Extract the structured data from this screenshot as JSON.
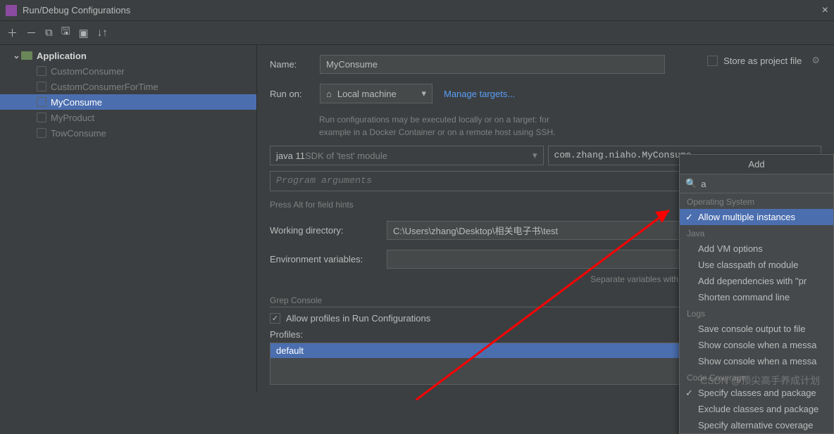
{
  "window": {
    "title": "Run/Debug Configurations"
  },
  "tree": {
    "header": "Application",
    "items": [
      "CustomConsumer",
      "CustomConsumerForTime",
      "MyConsume",
      "MyProduct",
      "TowConsume"
    ],
    "selected_index": 2
  },
  "form": {
    "name_label": "Name:",
    "name_value": "MyConsume",
    "store_label": "Store as project file",
    "runon_label": "Run on:",
    "runon_value": "Local machine",
    "manage_targets": "Manage targets...",
    "runon_hint1": "Run configurations may be executed locally or on a target: for",
    "runon_hint2": "example in a Docker Container or on a remote host using SSH.",
    "sdk_text": "java 11",
    "sdk_hint": " SDK of 'test' module",
    "main_class": "com.zhang.niaho.MyConsume",
    "prog_args_placeholder": "Program arguments",
    "alt_hint": "Press Alt for field hints",
    "workdir_label": "Working directory:",
    "workdir_value": "C:\\Users\\zhang\\Desktop\\相关电子书\\test",
    "env_label": "Environment variables:",
    "env_hint": "Separate variables with semicolon: VAR=value; VAR1=value1",
    "grep_label": "Grep Console",
    "allow_profiles": "Allow profiles in Run Configurations",
    "profiles_label": "Profiles:",
    "profiles_item": "default"
  },
  "popup": {
    "header": "Add",
    "search_value": "a",
    "categories": [
      {
        "name": "Operating System",
        "items": [
          {
            "label": "Allow multiple instances",
            "selected": true,
            "checked": true
          }
        ]
      },
      {
        "name": "Java",
        "items": [
          {
            "label": "Add VM options"
          },
          {
            "label": "Use classpath of module"
          },
          {
            "label": "Add dependencies with \"pr"
          },
          {
            "label": "Shorten command line"
          }
        ]
      },
      {
        "name": "Logs",
        "items": [
          {
            "label": "Save console output to file"
          },
          {
            "label": "Show console when a messa"
          },
          {
            "label": "Show console when a messa"
          }
        ]
      },
      {
        "name": "Code Coverage",
        "items": [
          {
            "label": "Specify classes and package",
            "checked": true
          },
          {
            "label": "Exclude classes and package"
          },
          {
            "label": "Specify alternative coverage"
          }
        ]
      }
    ]
  },
  "watermark": "CSDN @顶尖高手养成计划"
}
